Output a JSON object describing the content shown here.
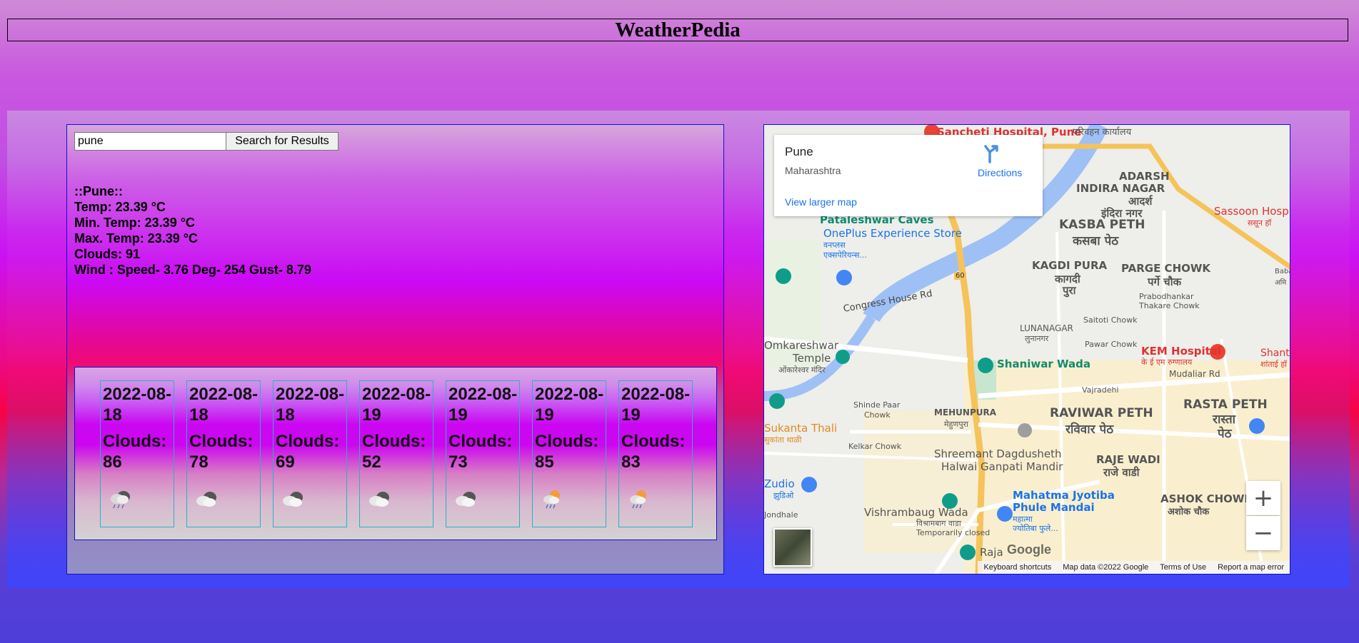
{
  "app": {
    "title": "WeatherPedia"
  },
  "search": {
    "value": "pune",
    "button_label": "Search for Results"
  },
  "current": {
    "city_line": "::Pune::",
    "temp_line": "Temp: 23.39 °C",
    "min_temp_line": "Min. Temp: 23.39 °C",
    "max_temp_line": "Max. Temp: 23.39 °C",
    "clouds_line": "Clouds: 91",
    "wind_line": "Wind : Speed- 3.76 Deg- 254 Gust- 8.79"
  },
  "forecast": [
    {
      "date": "2022-08-18",
      "clouds": "Clouds: 86",
      "icon": "rain-cloud-icon"
    },
    {
      "date": "2022-08-18",
      "clouds": "Clouds: 78",
      "icon": "broken-clouds-icon"
    },
    {
      "date": "2022-08-18",
      "clouds": "Clouds: 69",
      "icon": "broken-clouds-icon"
    },
    {
      "date": "2022-08-19",
      "clouds": "Clouds: 52",
      "icon": "broken-clouds-icon"
    },
    {
      "date": "2022-08-19",
      "clouds": "Clouds: 73",
      "icon": "broken-clouds-icon"
    },
    {
      "date": "2022-08-19",
      "clouds": "Clouds: 85",
      "icon": "sun-rain-icon"
    },
    {
      "date": "2022-08-19",
      "clouds": "Clouds: 83",
      "icon": "sun-rain-icon"
    }
  ],
  "map": {
    "place_name": "Pune",
    "region": "Maharashtra",
    "directions_label": "Directions",
    "larger_map_link": "View larger map",
    "zoom_in_label": "+",
    "zoom_out_label": "−",
    "google_logo": "Google",
    "footer": {
      "shortcuts": "Keyboard shortcuts",
      "map_data": "Map data ©2022 Google",
      "terms": "Terms of Use",
      "report": "Report a map error"
    },
    "labels": [
      "Sancheti Hospital, Pune",
      "परिवहन कार्यालय",
      "ADARSH",
      "INDIRA NAGAR",
      "आदर्श",
      "इंदिरा नगर",
      "Sassoon Hosp",
      "ससून हॉ",
      "Pataleshwar Caves",
      "OnePlus Experience Store",
      "वनप्लस",
      "एक्सपेरियन्स...",
      "KASBA PETH",
      "कसबा पेठ",
      "KAGDI PURA",
      "कागदी",
      "पुरा",
      "PARGE CHOWK",
      "पर्गे चौक",
      "Prabodhankar",
      "Thakare Chowk",
      "Congress House Rd",
      "LUNANAGAR",
      "लुनानगर",
      "Saitoti Chowk",
      "Pawar Chowk",
      "Omkareshwar",
      "Temple",
      "ओंकारेश्वर मंदिर",
      "Shaniwar Wada",
      "KEM Hospital",
      "के ई एम रुग्णालय",
      "Mudaliar Rd",
      "Shant",
      "शांताई हॉ",
      "Shinde Paar",
      "Chowk",
      "MEHUNPURA",
      "मेहुणपुरा",
      "Vajradehi",
      "RAVIWAR PETH",
      "रविवार पेठ",
      "RASTA PETH",
      "रास्ता",
      "पेठ",
      "Sukanta Thali",
      "सुकांता थाळी",
      "Kelkar Chowk",
      "Shreemant Dagdusheth",
      "Halwai Ganpati Mandir",
      "RAJE WADI",
      "राजे वाडी",
      "Zudio",
      "झुडिओ",
      "Mahatma Jyotiba",
      "Phule Mandai",
      "महात्मा",
      "ज्योतिबा फुले...",
      "ASHOK CHOWK",
      "अशोक चौक",
      "Jondhale",
      "Vishrambaug Wada",
      "विश्रामबाग वाडा",
      "Temporarily closed",
      "Raja",
      "60",
      "Baba",
      "अमि"
    ]
  }
}
